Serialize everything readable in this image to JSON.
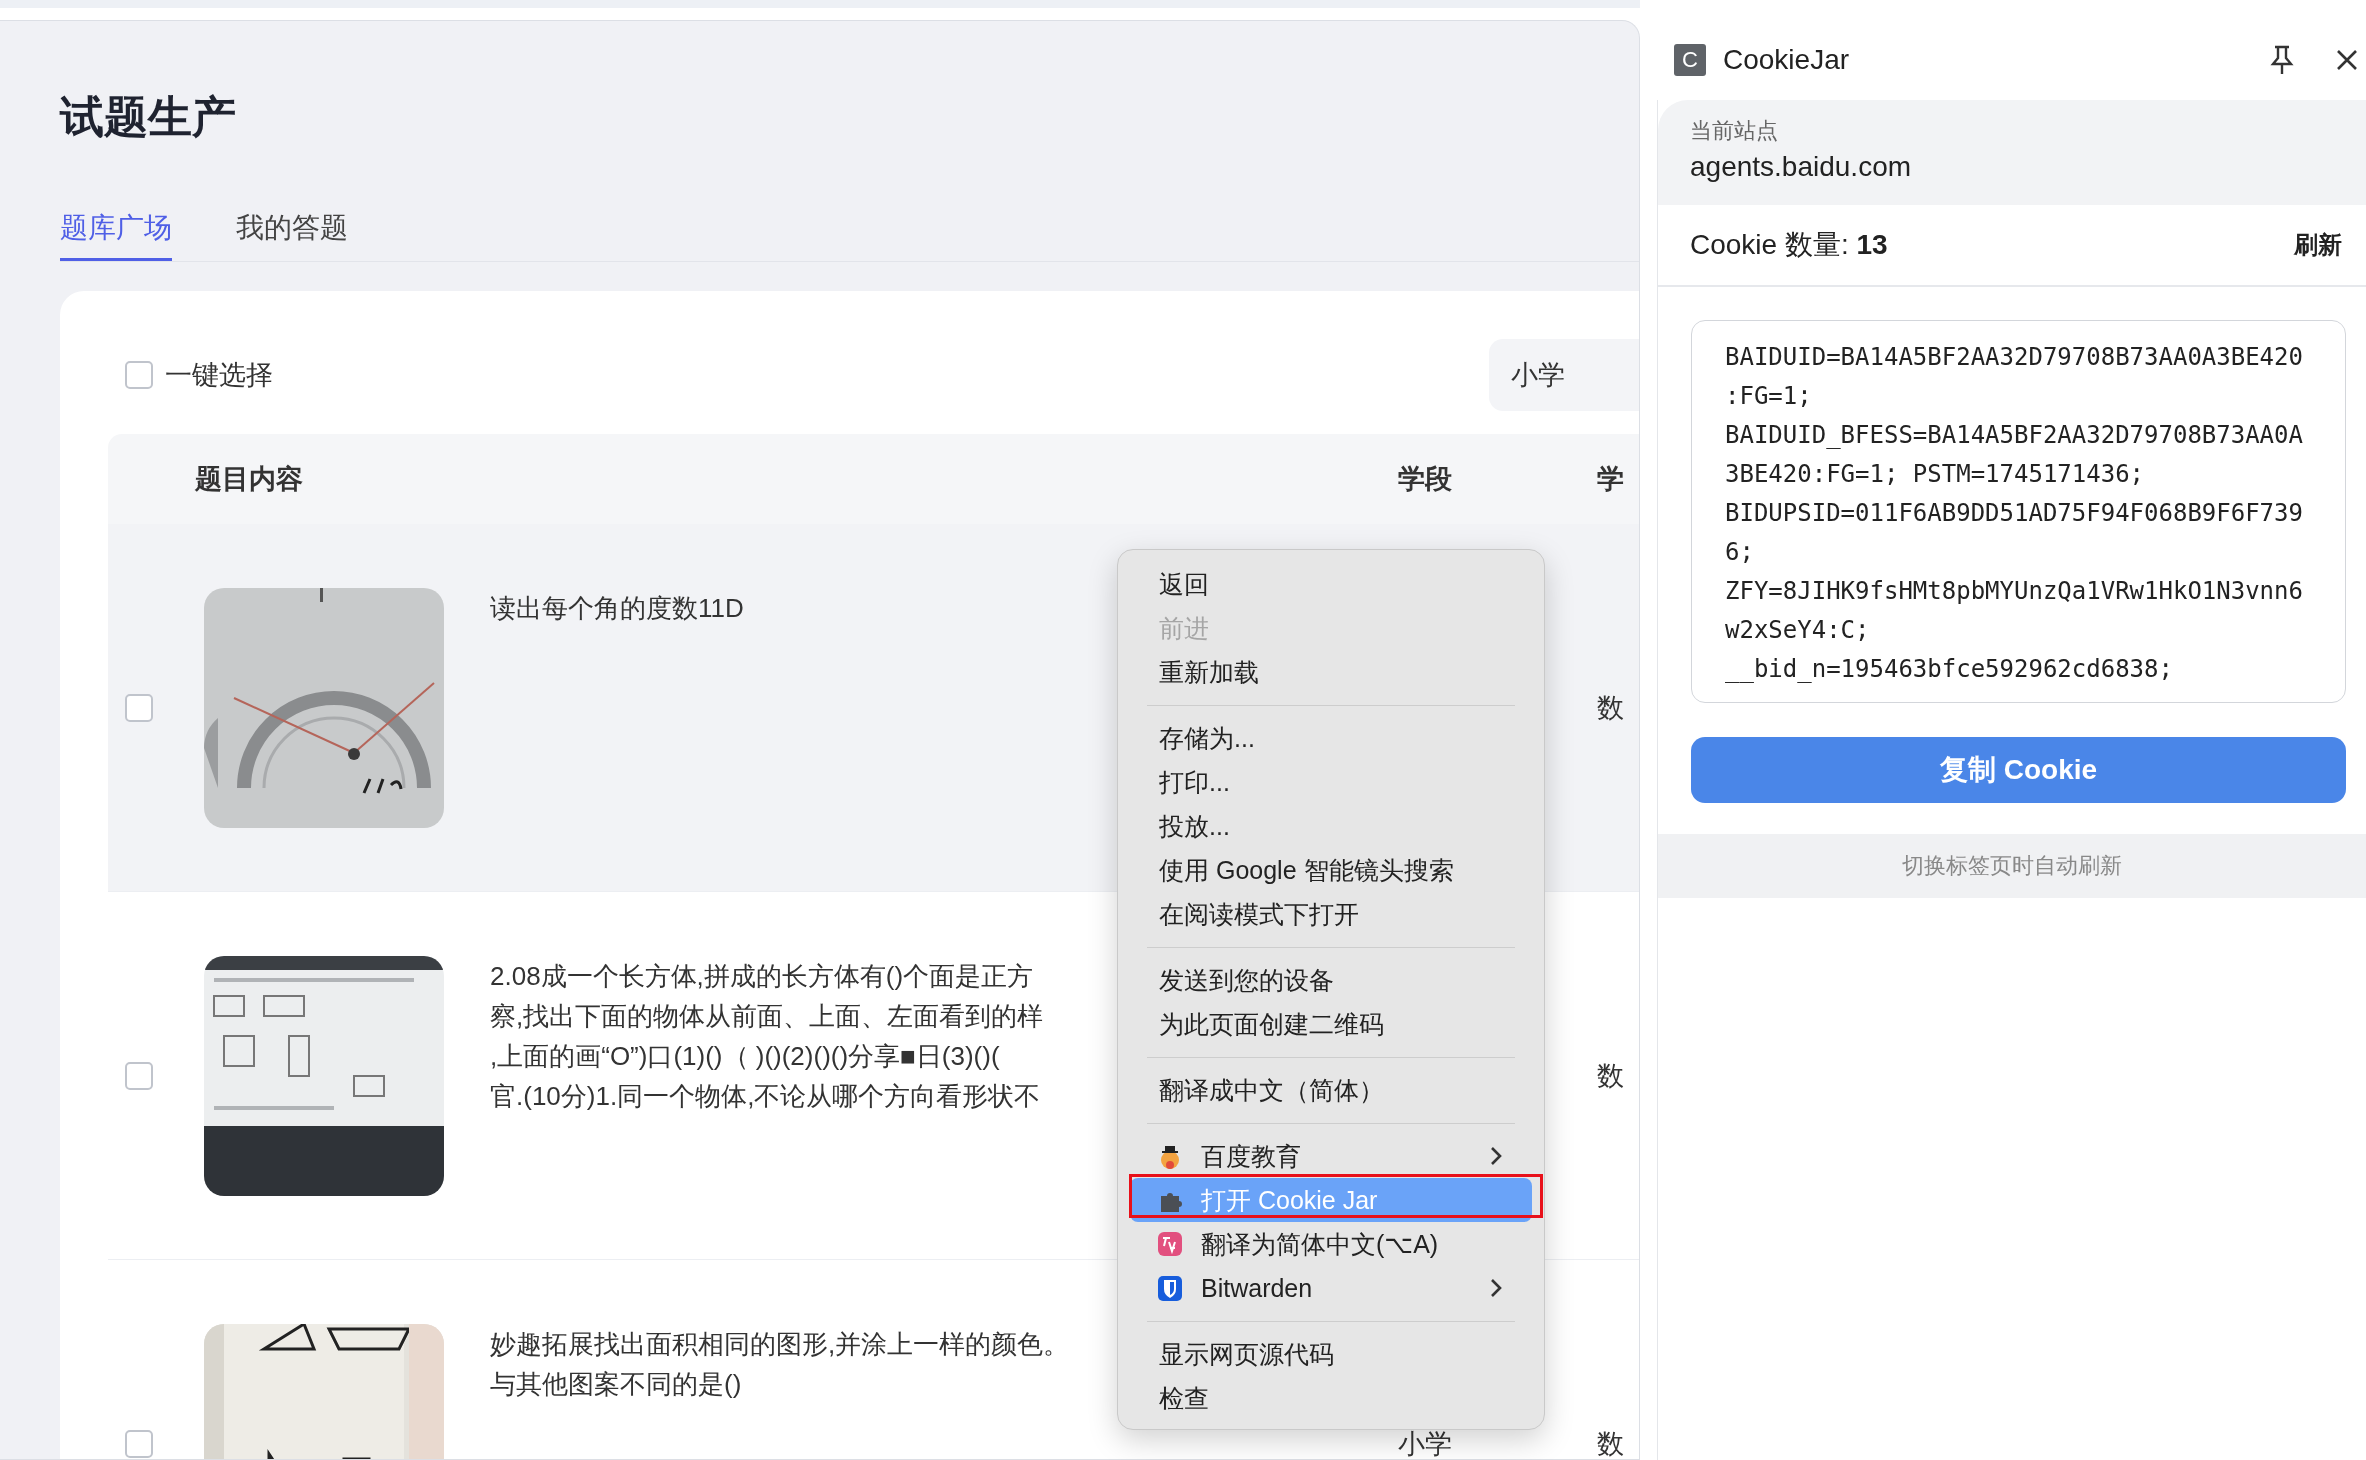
{
  "page": {
    "title": "试题生产"
  },
  "tabs": [
    {
      "label": "题库广场",
      "selected": true
    },
    {
      "label": "我的答题",
      "selected": false
    }
  ],
  "toolbar": {
    "select_all": {
      "label": "一键选择",
      "checked": false
    },
    "stage_filter": {
      "value": "小学"
    }
  },
  "table": {
    "columns": [
      {
        "label": "题目内容"
      },
      {
        "label": "学段"
      },
      {
        "label": "学"
      }
    ],
    "rows": [
      {
        "checked": false,
        "highlighted": true,
        "question_lines": [
          "读出每个角的度数11D"
        ],
        "subject": "数"
      },
      {
        "checked": false,
        "highlighted": false,
        "question_lines": [
          "2.08成一个长方体,拼成的长方体有()个面是正方",
          "察,找出下面的物体从前面、上面、左面看到的样",
          ",上面的画“O”)口(1)()（ )()(2)()()分享■日(3)()(",
          "官.(10分)1.同一个物体,不论从哪个方向看形状不"
        ],
        "subject": "数"
      },
      {
        "checked": false,
        "highlighted": false,
        "question_lines": [
          "妙趣拓展找出面积相同的图形,并涂上一样的颜色。",
          "与其他图案不同的是()"
        ],
        "stage": "小学",
        "subject": "数"
      }
    ]
  },
  "context_menu": {
    "items": [
      {
        "kind": "item",
        "label": "返回",
        "disabled": false,
        "selected": false,
        "submenu": false,
        "annotated": false
      },
      {
        "kind": "item",
        "label": "前进",
        "disabled": true,
        "selected": false,
        "submenu": false,
        "annotated": false
      },
      {
        "kind": "item",
        "label": "重新加载",
        "disabled": false,
        "selected": false,
        "submenu": false,
        "annotated": false
      },
      {
        "kind": "separator"
      },
      {
        "kind": "item",
        "label": "存储为...",
        "disabled": false,
        "selected": false,
        "submenu": false,
        "annotated": false
      },
      {
        "kind": "item",
        "label": "打印...",
        "disabled": false,
        "selected": false,
        "submenu": false,
        "annotated": false
      },
      {
        "kind": "item",
        "label": "投放...",
        "disabled": false,
        "selected": false,
        "submenu": false,
        "annotated": false
      },
      {
        "kind": "item",
        "label": "使用 Google 智能镜头搜索",
        "disabled": false,
        "selected": false,
        "submenu": false,
        "annotated": false
      },
      {
        "kind": "item",
        "label": "在阅读模式下打开",
        "disabled": false,
        "selected": false,
        "submenu": false,
        "annotated": false
      },
      {
        "kind": "separator"
      },
      {
        "kind": "item",
        "label": "发送到您的设备",
        "disabled": false,
        "selected": false,
        "submenu": false,
        "annotated": false
      },
      {
        "kind": "item",
        "label": "为此页面创建二维码",
        "disabled": false,
        "selected": false,
        "submenu": false,
        "annotated": false
      },
      {
        "kind": "separator"
      },
      {
        "kind": "item",
        "label": "翻译成中文（简体）",
        "disabled": false,
        "selected": false,
        "submenu": false,
        "annotated": false
      },
      {
        "kind": "separator"
      },
      {
        "kind": "app",
        "label": "百度教育",
        "disabled": false,
        "selected": false,
        "submenu": true,
        "annotated": false
      },
      {
        "kind": "app",
        "label": "打开 Cookie Jar",
        "disabled": false,
        "selected": true,
        "submenu": false,
        "annotated": true
      },
      {
        "kind": "app",
        "label": "翻译为简体中文(⌥A)",
        "disabled": false,
        "selected": false,
        "submenu": false,
        "annotated": false
      },
      {
        "kind": "app",
        "label": "Bitwarden",
        "disabled": false,
        "selected": false,
        "submenu": true,
        "annotated": false
      },
      {
        "kind": "separator"
      },
      {
        "kind": "item",
        "label": "显示网页源代码",
        "disabled": false,
        "selected": false,
        "submenu": false,
        "annotated": false
      },
      {
        "kind": "item",
        "label": "检查",
        "disabled": false,
        "selected": false,
        "submenu": false,
        "annotated": false
      }
    ]
  },
  "cookie_panel": {
    "app_letter": "C",
    "title": "CookieJar",
    "site_label": "当前站点",
    "site": "agents.baidu.com",
    "count_text": "Cookie 数量: **13**",
    "refresh": "刷新",
    "cookie_lines": [
      "BAIDUID=BA14A5BF2AA32D79708B73AA0A3BE420",
      ":FG=1;",
      "BAIDUID_BFESS=BA14A5BF2AA32D79708B73AA0A",
      "3BE420:FG=1; PSTM=1745171436;",
      "BIDUPSID=011F6AB9DD51AD75F94F068B9F6F739",
      "6;",
      "ZFY=8JIHK9fsHMt8pbMYUnzQa1VRw1HkO1N3vnn6",
      "w2xSeY4:C;",
      "__bid_n=195463bfce592962cd6838;"
    ],
    "copy_button": "复制 Cookie",
    "footer": "切换标签页时自动刷新"
  }
}
